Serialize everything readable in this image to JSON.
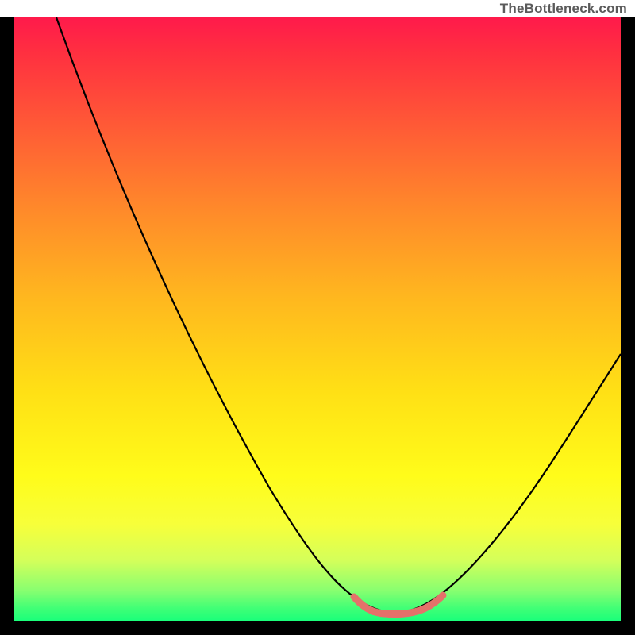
{
  "attribution": "TheBottleneck.com",
  "colors": {
    "page_bg": "#000000",
    "attribution_bg": "#ffffff",
    "attribution_text": "#5b5b5b",
    "curve_stroke": "#000000",
    "bottom_highlight": "#e4716a"
  },
  "chart_data": {
    "type": "line",
    "title": "",
    "xlabel": "",
    "ylabel": "",
    "xlim": [
      0,
      100
    ],
    "ylim": [
      0,
      100
    ],
    "x": [
      7,
      10,
      15,
      20,
      25,
      30,
      35,
      40,
      45,
      50,
      53,
      55,
      57,
      59,
      60,
      62,
      64,
      66,
      68,
      71,
      75,
      80,
      85,
      90,
      95,
      100
    ],
    "values": [
      100,
      94,
      85,
      76,
      67,
      58,
      49,
      40,
      31,
      22,
      16,
      12,
      8,
      5,
      4,
      3,
      3,
      4,
      6,
      10,
      16,
      24,
      32,
      40,
      48,
      56
    ],
    "annotations": [
      {
        "text": "flat bottom highlight",
        "x_range": [
          57,
          71
        ],
        "y": 3
      }
    ],
    "gradient_stops": [
      {
        "pct": 0,
        "color": "#ff1a4b"
      },
      {
        "pct": 18,
        "color": "#ff5a36"
      },
      {
        "pct": 46,
        "color": "#ffb61f"
      },
      {
        "pct": 76,
        "color": "#fffc1a"
      },
      {
        "pct": 95,
        "color": "#88ff70"
      },
      {
        "pct": 100,
        "color": "#1aff7a"
      }
    ]
  }
}
